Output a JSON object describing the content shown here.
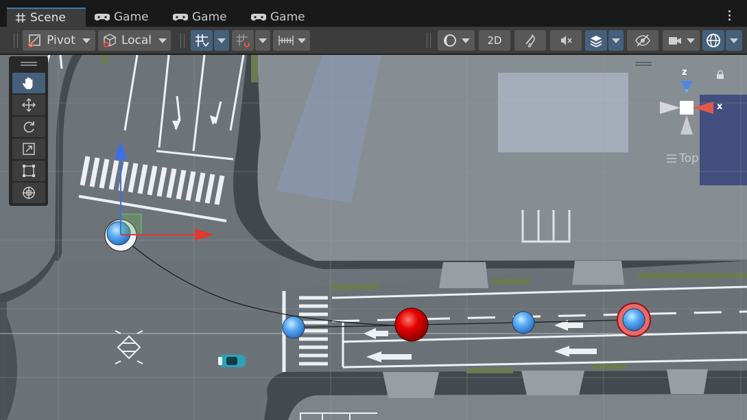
{
  "tabs": [
    {
      "label": "Scene",
      "icon": "grid-hash-icon",
      "active": true
    },
    {
      "label": "Game",
      "icon": "gamepad-icon",
      "active": false
    },
    {
      "label": "Game",
      "icon": "gamepad-icon",
      "active": false
    },
    {
      "label": "Game",
      "icon": "gamepad-icon",
      "active": false
    }
  ],
  "toolbar": {
    "pivot_label": "Pivot",
    "local_label": "Local",
    "mode_2d_label": "2D",
    "grid_snap_active": true,
    "gizmos_active": true
  },
  "tools": [
    {
      "name": "hand-tool",
      "active": true
    },
    {
      "name": "move-tool",
      "active": false
    },
    {
      "name": "rotate-tool",
      "active": false
    },
    {
      "name": "scale-tool",
      "active": false
    },
    {
      "name": "rect-tool",
      "active": false
    },
    {
      "name": "transform-tool",
      "active": false
    }
  ],
  "scene": {
    "view_label": "Top",
    "axis_x": "x",
    "axis_z": "z",
    "waypoint_colors": {
      "blue": "#3f9cf0",
      "red": "#e20000"
    },
    "accent_color": "#46607c"
  }
}
